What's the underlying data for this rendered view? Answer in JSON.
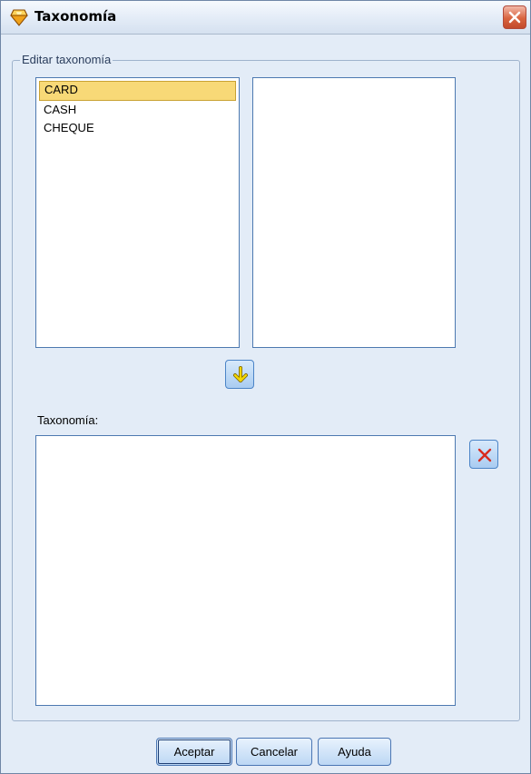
{
  "window": {
    "title": "Taxonomía"
  },
  "groupbox": {
    "legend": "Editar taxonomía"
  },
  "source_list": {
    "items": [
      "CARD",
      "CASH",
      "CHEQUE"
    ],
    "selected_index": 0
  },
  "target_list": {
    "items": []
  },
  "taxonomy": {
    "label": "Taxonomía:",
    "items": []
  },
  "buttons": {
    "ok": "Aceptar",
    "cancel": "Cancelar",
    "help": "Ayuda"
  },
  "colors": {
    "selection": "#f8d977",
    "arrow": "#f2d600",
    "delete": "#d92b1e",
    "close": "#d9643f"
  },
  "icons": [
    "app-icon",
    "close-icon",
    "arrow-down-icon",
    "delete-icon"
  ]
}
